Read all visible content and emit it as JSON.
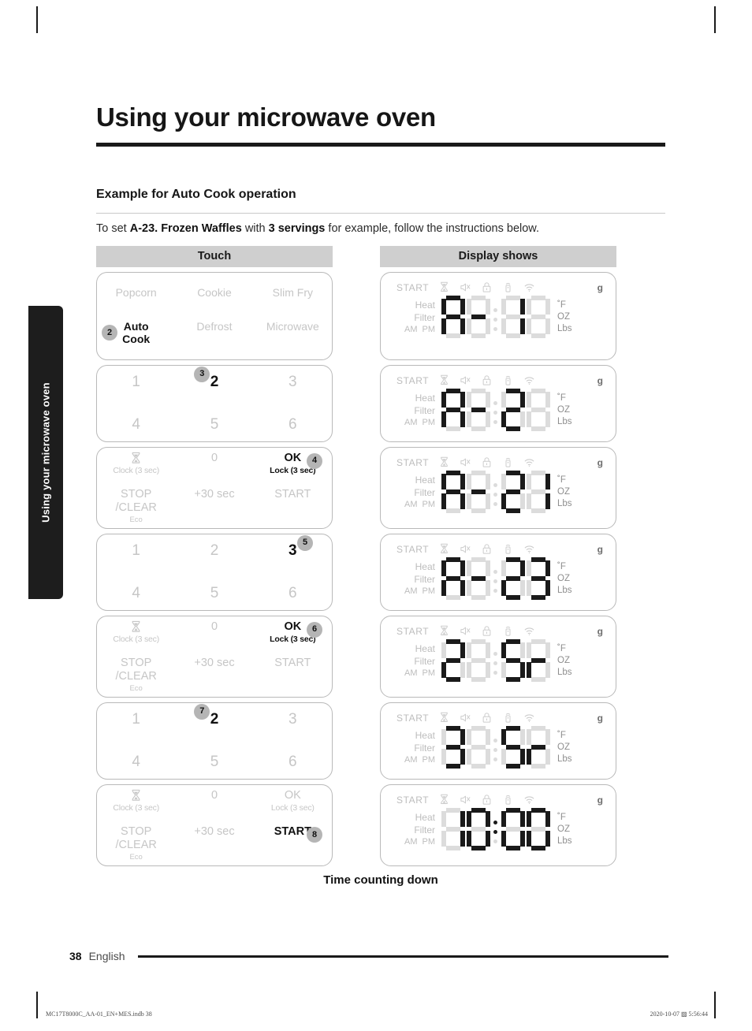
{
  "side_tab": {
    "label": "Using your microwave oven"
  },
  "page": {
    "title": "Using your microwave oven",
    "section_title": "Example for Auto Cook operation",
    "intro": {
      "lead": "To set ",
      "bold1": "A-23. Frozen Waffles",
      "mid": " with ",
      "bold2": "3 servings",
      "tail": " for example, follow the instructions below."
    }
  },
  "table": {
    "headers": {
      "touch": "Touch",
      "display": "Display shows"
    },
    "rows": [
      {
        "panel_type": "menu",
        "keys": [
          {
            "label": "Popcorn",
            "active": false
          },
          {
            "label": "Cookie",
            "active": false
          },
          {
            "label": "Slim Fry",
            "active": false
          },
          {
            "label": "Auto\nCook",
            "active": true,
            "badge": "2",
            "badge_pos": "left"
          },
          {
            "label": "Defrost",
            "active": false
          },
          {
            "label": "Microwave",
            "active": false
          }
        ],
        "display": {
          "digits": [
            "A",
            "-",
            "1",
            " "
          ],
          "colon": "off"
        }
      },
      {
        "panel_type": "num",
        "keys": [
          {
            "label": "1",
            "active": false
          },
          {
            "label": "2",
            "active": true,
            "badge": "3",
            "badge_pos": "topleft"
          },
          {
            "label": "3",
            "active": false
          },
          {
            "label": "4",
            "active": false
          },
          {
            "label": "5",
            "active": false
          },
          {
            "label": "6",
            "active": false
          }
        ],
        "display": {
          "digits": [
            "A",
            "-",
            "2",
            " "
          ],
          "colon": "off"
        }
      },
      {
        "panel_type": "ctrl",
        "keys": [
          {
            "label": "",
            "icon": "hourglass-icon",
            "sub": "Clock (3 sec)",
            "active": false
          },
          {
            "label": "0",
            "active": false
          },
          {
            "label": "OK",
            "sub": "Lock (3 sec)",
            "active": true,
            "badge": "4",
            "badge_pos": "right"
          },
          {
            "label": "STOP\n/CLEAR",
            "sub2": "Eco",
            "active": false
          },
          {
            "label": "+30 sec",
            "active": false
          },
          {
            "label": "START",
            "active": false
          }
        ],
        "display": {
          "digits": [
            "A",
            "-",
            "2",
            "1"
          ],
          "colon": "off"
        }
      },
      {
        "panel_type": "num",
        "keys": [
          {
            "label": "1",
            "active": false
          },
          {
            "label": "2",
            "active": false
          },
          {
            "label": "3",
            "active": true,
            "badge": "5",
            "badge_pos": "topright"
          },
          {
            "label": "4",
            "active": false
          },
          {
            "label": "5",
            "active": false
          },
          {
            "label": "6",
            "active": false
          }
        ],
        "display": {
          "digits": [
            "A",
            "-",
            "2",
            "3"
          ],
          "colon": "off"
        }
      },
      {
        "panel_type": "ctrl",
        "keys": [
          {
            "label": "",
            "icon": "hourglass-icon",
            "sub": "Clock (3 sec)",
            "active": false
          },
          {
            "label": "0",
            "active": false
          },
          {
            "label": "OK",
            "sub": "Lock (3 sec)",
            "active": true,
            "badge": "6",
            "badge_pos": "right"
          },
          {
            "label": "STOP\n/CLEAR",
            "sub2": "Eco",
            "active": false
          },
          {
            "label": "+30 sec",
            "active": false
          },
          {
            "label": "START",
            "active": false
          }
        ],
        "display": {
          "digits": [
            "2",
            " ",
            "5",
            "r"
          ],
          "colon": "off"
        }
      },
      {
        "panel_type": "num",
        "keys": [
          {
            "label": "1",
            "active": false
          },
          {
            "label": "2",
            "active": true,
            "badge": "7",
            "badge_pos": "topleft"
          },
          {
            "label": "3",
            "active": false
          },
          {
            "label": "4",
            "active": false
          },
          {
            "label": "5",
            "active": false
          },
          {
            "label": "6",
            "active": false
          }
        ],
        "display": {
          "digits": [
            "3",
            " ",
            "5",
            "r"
          ],
          "colon": "off"
        }
      },
      {
        "panel_type": "ctrl",
        "keys": [
          {
            "label": "",
            "icon": "hourglass-icon",
            "sub": "Clock (3 sec)",
            "active": false
          },
          {
            "label": "0",
            "active": false
          },
          {
            "label": "OK",
            "sub": "Lock (3 sec)",
            "active": false
          },
          {
            "label": "STOP\n/CLEAR",
            "sub2": "Eco",
            "active": false
          },
          {
            "label": "+30 sec",
            "active": false
          },
          {
            "label": "START",
            "active": true,
            "badge": "8",
            "badge_pos": "right"
          }
        ],
        "display": {
          "digits": [
            "1",
            "0",
            "0",
            "0"
          ],
          "colon": "on"
        }
      }
    ],
    "caption": "Time counting down"
  },
  "display_labels": {
    "start": "START",
    "heat": "Heat",
    "filter": "Filter",
    "am": "AM",
    "pm": "PM",
    "g": "g",
    "f": "˚F",
    "oz": "OZ",
    "lbs": "Lbs",
    "icons": [
      "hourglass-icon",
      "mute-icon",
      "lock-icon",
      "remote-icon",
      "wifi-icon"
    ]
  },
  "footer": {
    "page_number": "38",
    "language": "English"
  },
  "print_marks": {
    "left": "MC17T8000C_AA-01_EN+MES.indb   38",
    "right": "2020-10-07   ▨ 5:56:44"
  }
}
